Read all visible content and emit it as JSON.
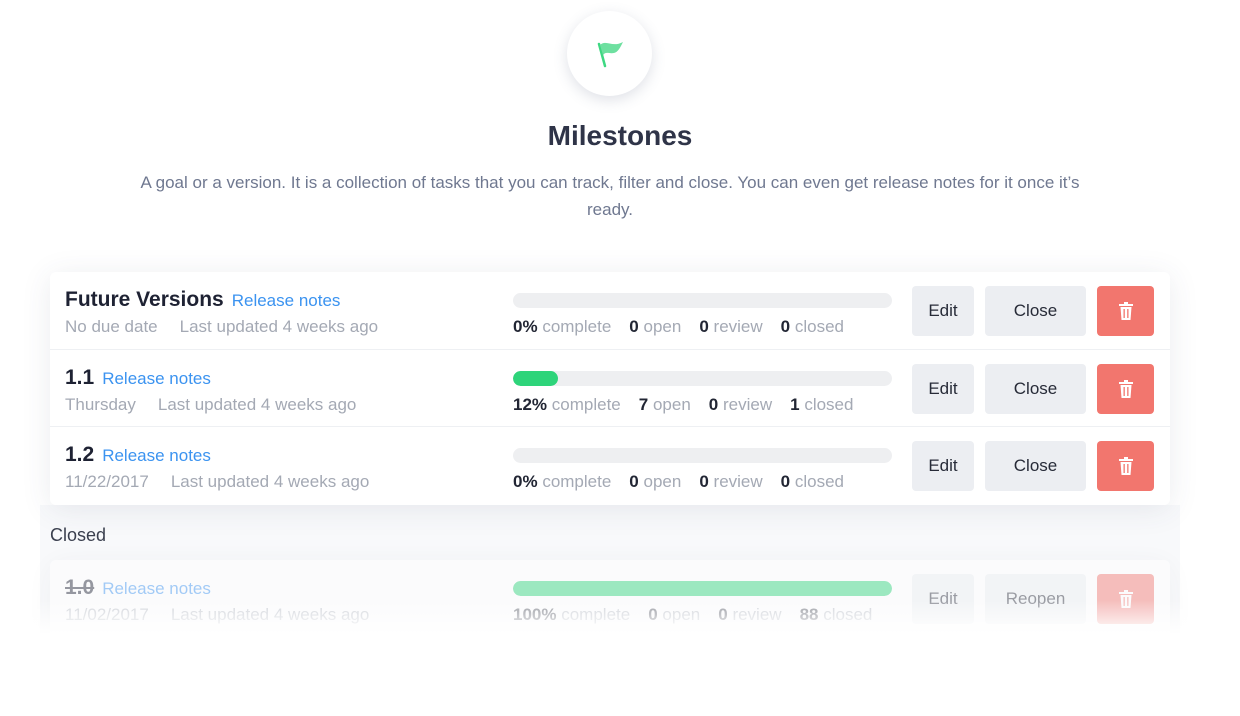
{
  "header": {
    "icon": "flag-icon",
    "title": "Milestones",
    "description": "A goal or a version. It is a collection of tasks that you can track, filter and close. You can even get release notes for it once it’s ready."
  },
  "colors": {
    "accent": "#3b93f0",
    "progress": "#2ed47a",
    "delete": "#f2766e"
  },
  "open_milestones": [
    {
      "name": "Future Versions",
      "release_notes": "Release notes",
      "due": "No due date",
      "updated": "Last updated 4 weeks ago",
      "percent": 0,
      "percent_label": "0%",
      "complete": "complete",
      "open": "0",
      "review": "0",
      "closed": "0",
      "edit": "Edit",
      "action": "Close"
    },
    {
      "name": "1.1",
      "release_notes": "Release notes",
      "due": "Thursday",
      "updated": "Last updated 4 weeks ago",
      "percent": 12,
      "percent_label": "12%",
      "complete": "complete",
      "open": "7",
      "review": "0",
      "closed": "1",
      "edit": "Edit",
      "action": "Close"
    },
    {
      "name": "1.2",
      "release_notes": "Release notes",
      "due": "11/22/2017",
      "updated": "Last updated 4 weeks ago",
      "percent": 0,
      "percent_label": "0%",
      "complete": "complete",
      "open": "0",
      "review": "0",
      "closed": "0",
      "edit": "Edit",
      "action": "Close"
    }
  ],
  "labels": {
    "open": "open",
    "review": "review",
    "closed": "closed"
  },
  "closed_section": {
    "label": "Closed",
    "milestones": [
      {
        "name": "1.0",
        "release_notes": "Release notes",
        "due": "11/02/2017",
        "updated": "Last updated 4 weeks ago",
        "percent": 100,
        "percent_label": "100%",
        "complete": "complete",
        "open": "0",
        "review": "0",
        "closed": "88",
        "edit": "Edit",
        "action": "Reopen"
      }
    ]
  }
}
